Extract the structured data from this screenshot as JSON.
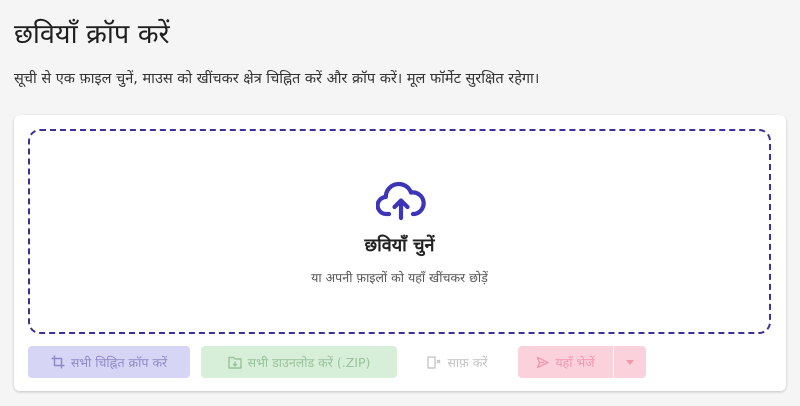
{
  "header": {
    "title": "छवियाँ क्रॉप करें",
    "description": "सूची से एक फ़ाइल चुनें, माउस को खींचकर क्षेत्र चिह्नित करें और क्रॉप करें। मूल फॉर्मेट सुरक्षित रहेगा।"
  },
  "dropzone": {
    "icon": "cloud-upload-icon",
    "title": "छवियाँ चुनें",
    "subtitle": "या अपनी फ़ाइलों को यहाँ खींचकर छोड़ें",
    "border_color": "#3b3196",
    "icon_color": "#3d35b8"
  },
  "toolbar": {
    "crop_all_label": "सभी चिह्नित क्रॉप करें",
    "download_zip_label": "सभी डाउनलोड करें (.ZIP)",
    "clear_label": "साफ़ करें",
    "send_label": "यहाँ भेजें"
  },
  "colors": {
    "crop_button": "#d7d5f5",
    "zip_button": "#d7eed9",
    "send_button": "#fbd2dc"
  }
}
